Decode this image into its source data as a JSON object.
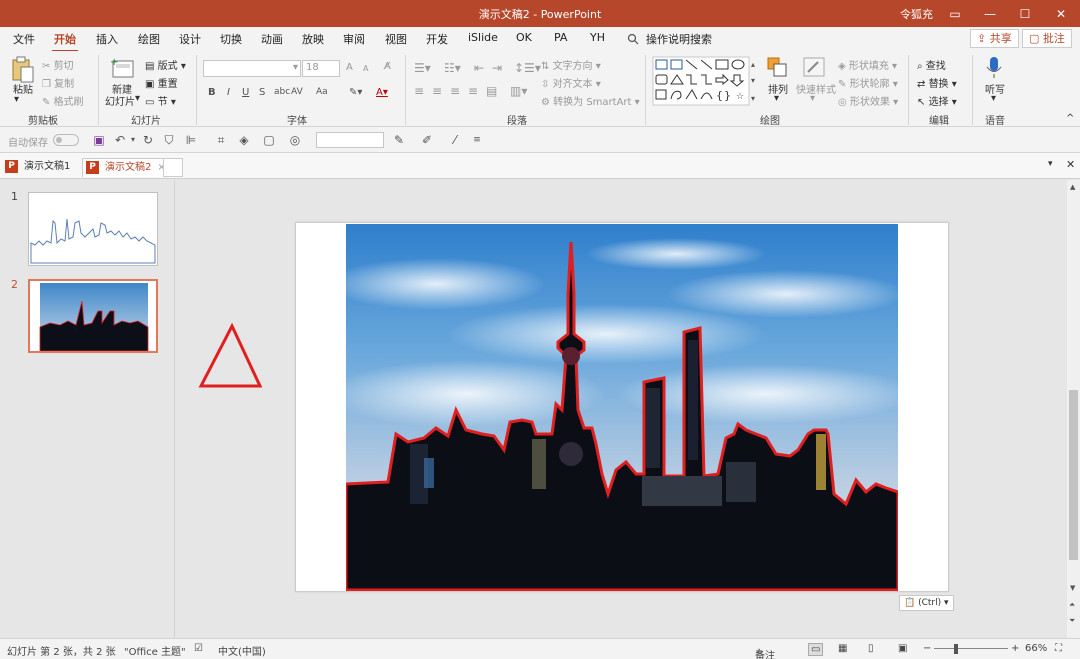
{
  "app": {
    "title": "演示文稿2  -  PowerPoint",
    "user": "令狐充"
  },
  "window_buttons": [
    "▭",
    "—",
    "☐",
    "✕"
  ],
  "ribbon_tabs": [
    {
      "label": "文件",
      "active": false
    },
    {
      "label": "开始",
      "active": true
    },
    {
      "label": "插入",
      "active": false
    },
    {
      "label": "绘图",
      "active": false
    },
    {
      "label": "设计",
      "active": false
    },
    {
      "label": "切换",
      "active": false
    },
    {
      "label": "动画",
      "active": false
    },
    {
      "label": "放映",
      "active": false
    },
    {
      "label": "审阅",
      "active": false
    },
    {
      "label": "视图",
      "active": false
    },
    {
      "label": "开发",
      "active": false
    },
    {
      "label": "iSlide",
      "active": false
    },
    {
      "label": "OK",
      "active": false
    },
    {
      "label": "PA",
      "active": false
    },
    {
      "label": "YH",
      "active": false
    }
  ],
  "tell_me": "操作说明搜索",
  "share_label": "共享",
  "comment_label": "批注",
  "clipboard": {
    "paste": "粘贴",
    "cut": "剪切",
    "copy": "复制",
    "format_painter": "格式刷",
    "group": "剪贴板"
  },
  "slides_group": {
    "new_slide_1": "新建",
    "new_slide_2": "幻灯片",
    "layout": "版式",
    "reset": "重置",
    "section": "节",
    "group": "幻灯片"
  },
  "font_group": {
    "font_size": "18",
    "bold": "B",
    "italic": "I",
    "underline": "U",
    "shadow": "S",
    "spacing": "AV",
    "case": "Aa",
    "grow": "A",
    "shrink": "A",
    "group": "字体"
  },
  "paragraph_group": {
    "text_direction": "文字方向",
    "align_text": "对齐文本",
    "smartart": "转换为 SmartArt",
    "group": "段落"
  },
  "drawing_group": {
    "arrange": "排列",
    "quick_styles": "快速样式",
    "shape_fill": "形状填充",
    "shape_outline": "形状轮廓",
    "shape_effects": "形状效果",
    "group": "绘图"
  },
  "editing_group": {
    "find": "查找",
    "replace": "替换",
    "select": "选择",
    "group": "编辑"
  },
  "voice_group": {
    "dictate": "听写",
    "group": "语音"
  },
  "quick_access": {
    "autosave": "自动保存"
  },
  "doc_tabs": [
    {
      "label": "演示文稿1",
      "active": false
    },
    {
      "label": "演示文稿2",
      "active": true
    }
  ],
  "slide_numbers": [
    "1",
    "2"
  ],
  "paste_options": "(Ctrl)",
  "status": {
    "slide_info": "幻灯片 第 2 张，共 2 张",
    "theme": "\"Office 主题\"",
    "language": "中文(中国)",
    "notes": "备注",
    "zoom": "66%"
  },
  "colors": {
    "accent": "#b7472a",
    "outline_red": "#e02020"
  }
}
